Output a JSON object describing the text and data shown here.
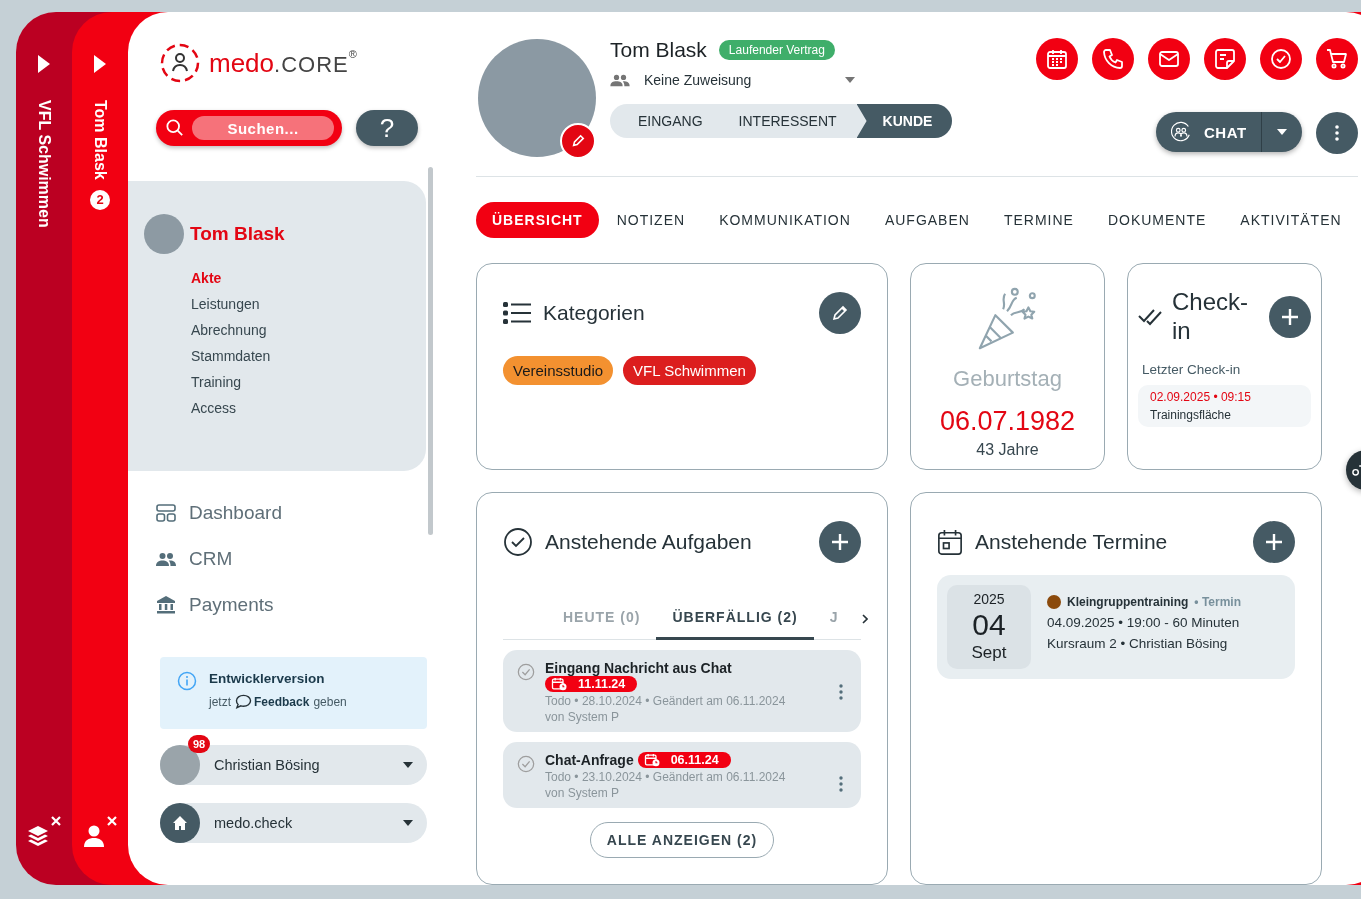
{
  "strips": [
    {
      "kind": "group",
      "label": "VFL Schwimmen"
    },
    {
      "kind": "person",
      "label": "Tom Blask",
      "badge": "2"
    }
  ],
  "logo": {
    "name": "medo",
    "suffix": ".CORE",
    "mark": "®"
  },
  "search": {
    "placeholder": "Suchen..."
  },
  "help_button": {
    "label": "?"
  },
  "contact": {
    "name": "Tom Blask",
    "items": [
      {
        "label": "Akte",
        "selected": true
      },
      {
        "label": "Leistungen",
        "selected": false
      },
      {
        "label": "Abrechnung",
        "selected": false
      },
      {
        "label": "Stammdaten",
        "selected": false
      },
      {
        "label": "Training",
        "selected": false
      },
      {
        "label": "Access",
        "selected": false
      }
    ]
  },
  "nav": [
    {
      "kind": "dashboard",
      "label": "Dashboard"
    },
    {
      "kind": "crm",
      "label": "CRM"
    },
    {
      "kind": "payments",
      "label": "Payments"
    }
  ],
  "notice": {
    "title": "Entwicklerversion",
    "before": "jetzt",
    "link": "Feedback",
    "after": "geben"
  },
  "user": {
    "name": "Christian Bösing",
    "badge": "98"
  },
  "workspace": {
    "name": "medo.check"
  },
  "profile": {
    "name": "Tom Blask",
    "status": "Laufender Vertrag",
    "assignment": "Keine Zuweisung",
    "stages": [
      {
        "label": "EINGANG",
        "selected": false
      },
      {
        "label": "INTERESSENT",
        "selected": false
      },
      {
        "label": "KUNDE",
        "selected": true
      }
    ]
  },
  "actions": [
    {
      "kind": "calendar"
    },
    {
      "kind": "phone"
    },
    {
      "kind": "mail"
    },
    {
      "kind": "note"
    },
    {
      "kind": "check"
    },
    {
      "kind": "cart"
    }
  ],
  "chat_button": {
    "label": "CHAT"
  },
  "tabs": [
    {
      "label": "ÜBERSICHT",
      "selected": true
    },
    {
      "label": "NOTIZEN",
      "selected": false
    },
    {
      "label": "KOMMUNIKATION",
      "selected": false
    },
    {
      "label": "AUFGABEN",
      "selected": false
    },
    {
      "label": "TERMINE",
      "selected": false
    },
    {
      "label": "DOKUMENTE",
      "selected": false
    },
    {
      "label": "AKTIVITÄTEN",
      "selected": false
    }
  ],
  "categories": {
    "title": "Kategorien",
    "tags": [
      {
        "label": "Vereinsstudio",
        "color": "#f39130"
      },
      {
        "label": "VFL Schwimmen",
        "color": "#dc1e1e"
      }
    ]
  },
  "birthday": {
    "title": "Geburtstag",
    "date": "06.07.1982",
    "age": "43 Jahre"
  },
  "checkin": {
    "title": "Check-in",
    "subtitle": "Letzter Check-in",
    "time": "02.09.2025 • 09:15",
    "place": "Trainingsfläche"
  },
  "tasks": {
    "title": "Anstehende Aufgaben",
    "tabs": [
      {
        "label": "HEUTE (0)",
        "selected": false
      },
      {
        "label": "ÜBERFÄLLIG (2)",
        "selected": true
      },
      {
        "label": "J",
        "selected": false
      }
    ],
    "items": [
      {
        "title": "Eingang Nachricht aus Chat",
        "due": "11.11.24",
        "meta": "Todo • 28.10.2024 • Geändert am 06.11.2024",
        "by": "von System P"
      },
      {
        "title": "Chat-Anfrage",
        "due": "06.11.24",
        "meta": "Todo • 23.10.2024 • Geändert am 06.11.2024",
        "by": "von System P"
      }
    ],
    "show_all": "ALLE ANZEIGEN (2)"
  },
  "appointments": {
    "title": "Anstehende Termine",
    "items": [
      {
        "year": "2025",
        "day": "04",
        "month": "Sept",
        "title": "Kleingruppentraining",
        "type": "• Termin",
        "color": "#8b4a0c",
        "when": "04.09.2025 • 19:00 - 60 Minuten",
        "where": "Kursraum 2 • Christian Bösing"
      }
    ]
  }
}
